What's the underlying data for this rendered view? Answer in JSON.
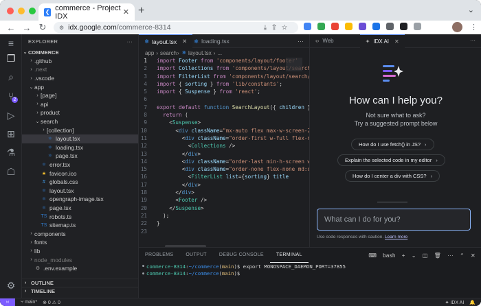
{
  "browser": {
    "tab_title": "commerce - Project IDX",
    "url_host": "idx.google.com",
    "url_path": "/commerce-8314"
  },
  "explorer": {
    "header": "EXPLORER",
    "root": "COMMERCE",
    "items": [
      {
        "label": ".github",
        "depth": 1,
        "kind": "folder",
        "open": false,
        "dim": false
      },
      {
        "label": ".next",
        "depth": 1,
        "kind": "folder",
        "open": false,
        "dim": true
      },
      {
        "label": ".vscode",
        "depth": 1,
        "kind": "folder",
        "open": false,
        "dim": false
      },
      {
        "label": "app",
        "depth": 1,
        "kind": "folder",
        "open": true,
        "dim": false
      },
      {
        "label": "[page]",
        "depth": 2,
        "kind": "folder",
        "open": false,
        "dim": false
      },
      {
        "label": "api",
        "depth": 2,
        "kind": "folder",
        "open": false,
        "dim": false
      },
      {
        "label": "product",
        "depth": 2,
        "kind": "folder",
        "open": false,
        "dim": false
      },
      {
        "label": "search",
        "depth": 2,
        "kind": "folder",
        "open": true,
        "dim": false
      },
      {
        "label": "[collection]",
        "depth": 3,
        "kind": "folder",
        "open": false,
        "dim": false
      },
      {
        "label": "layout.tsx",
        "depth": 3,
        "kind": "tsx",
        "selected": true
      },
      {
        "label": "loading.tsx",
        "depth": 3,
        "kind": "tsx"
      },
      {
        "label": "page.tsx",
        "depth": 3,
        "kind": "tsx"
      },
      {
        "label": "error.tsx",
        "depth": 2,
        "kind": "tsx"
      },
      {
        "label": "favicon.ico",
        "depth": 2,
        "kind": "ico"
      },
      {
        "label": "globals.css",
        "depth": 2,
        "kind": "css"
      },
      {
        "label": "layout.tsx",
        "depth": 2,
        "kind": "tsx"
      },
      {
        "label": "opengraph-image.tsx",
        "depth": 2,
        "kind": "tsx"
      },
      {
        "label": "page.tsx",
        "depth": 2,
        "kind": "tsx"
      },
      {
        "label": "robots.ts",
        "depth": 2,
        "kind": "ts"
      },
      {
        "label": "sitemap.ts",
        "depth": 2,
        "kind": "ts"
      },
      {
        "label": "components",
        "depth": 1,
        "kind": "folder",
        "open": false,
        "dim": false
      },
      {
        "label": "fonts",
        "depth": 1,
        "kind": "folder",
        "open": false,
        "dim": false
      },
      {
        "label": "lib",
        "depth": 1,
        "kind": "folder",
        "open": false,
        "dim": false
      },
      {
        "label": "node_modules",
        "depth": 1,
        "kind": "folder",
        "open": false,
        "dim": true
      },
      {
        "label": ".env.example",
        "depth": 1,
        "kind": "env"
      }
    ],
    "outline": "OUTLINE",
    "timeline": "TIMELINE"
  },
  "editor": {
    "tabs": [
      "layout.tsx",
      "loading.tsx"
    ],
    "breadcrumb": [
      "app",
      "search",
      "layout.tsx",
      "..."
    ],
    "lines": [
      [
        [
          "kw",
          "import "
        ],
        [
          "va",
          "Footer "
        ],
        [
          "kw",
          "from "
        ],
        [
          "st",
          "'components/layout/footer'"
        ]
      ],
      [
        [
          "kw",
          "import "
        ],
        [
          "va",
          "Collections "
        ],
        [
          "kw",
          "from "
        ],
        [
          "st",
          "'components/layout/search/collections'"
        ]
      ],
      [
        [
          "kw",
          "import "
        ],
        [
          "va",
          "FilterList "
        ],
        [
          "kw",
          "from "
        ],
        [
          "st",
          "'components/layout/search/filter'"
        ]
      ],
      [
        [
          "kw",
          "import "
        ],
        [
          "ct",
          "{ "
        ],
        [
          "va",
          "sorting "
        ],
        [
          "ct",
          "} "
        ],
        [
          "kw",
          "from "
        ],
        [
          "st",
          "'lib/constants'"
        ],
        [
          "ct",
          ";"
        ]
      ],
      [
        [
          "kw",
          "import "
        ],
        [
          "ct",
          "{ "
        ],
        [
          "va",
          "Suspense "
        ],
        [
          "ct",
          "} "
        ],
        [
          "kw",
          "from "
        ],
        [
          "st",
          "'react'"
        ],
        [
          "ct",
          ";"
        ]
      ],
      [],
      [
        [
          "kw",
          "export default "
        ],
        [
          "kb",
          "function "
        ],
        [
          "fn",
          "SearchLayout"
        ],
        [
          "ct",
          "({ "
        ],
        [
          "va",
          "children"
        ],
        [
          "ct",
          " }"
        ]
      ],
      [
        [
          "ct",
          "  "
        ],
        [
          "kw",
          "return "
        ],
        [
          "ct",
          "("
        ]
      ],
      [
        [
          "ct",
          "    <"
        ],
        [
          "tg",
          "Suspense"
        ],
        [
          "ct",
          ">"
        ]
      ],
      [
        [
          "ct",
          "      <"
        ],
        [
          "kb",
          "div "
        ],
        [
          "at",
          "className"
        ],
        [
          "ct",
          "="
        ],
        [
          "st",
          "\"mx-auto flex max-w-screen-2xl\""
        ]
      ],
      [
        [
          "ct",
          "        <"
        ],
        [
          "kb",
          "div "
        ],
        [
          "at",
          "className"
        ],
        [
          "ct",
          "="
        ],
        [
          "st",
          "\"order-first w-full flex-none\""
        ]
      ],
      [
        [
          "ct",
          "          <"
        ],
        [
          "tg",
          "Collections "
        ],
        [
          "ct",
          "/>"
        ]
      ],
      [
        [
          "ct",
          "        </"
        ],
        [
          "kb",
          "div"
        ],
        [
          "ct",
          ">"
        ]
      ],
      [
        [
          "ct",
          "        <"
        ],
        [
          "kb",
          "div "
        ],
        [
          "at",
          "className"
        ],
        [
          "ct",
          "="
        ],
        [
          "st",
          "\"order-last min-h-screen w-full\""
        ]
      ],
      [
        [
          "ct",
          "        <"
        ],
        [
          "kb",
          "div "
        ],
        [
          "at",
          "className"
        ],
        [
          "ct",
          "="
        ],
        [
          "st",
          "\"order-none flex-none md:order-last\""
        ]
      ],
      [
        [
          "ct",
          "          <"
        ],
        [
          "tg",
          "FilterList "
        ],
        [
          "at",
          "list"
        ],
        [
          "ct",
          "={"
        ],
        [
          "va",
          "sorting"
        ],
        [
          "ct",
          "} "
        ],
        [
          "at",
          "title"
        ]
      ],
      [
        [
          "ct",
          "        </"
        ],
        [
          "kb",
          "div"
        ],
        [
          "ct",
          ">"
        ]
      ],
      [
        [
          "ct",
          "      </"
        ],
        [
          "kb",
          "div"
        ],
        [
          "ct",
          ">"
        ]
      ],
      [
        [
          "ct",
          "      <"
        ],
        [
          "tg",
          "Footer "
        ],
        [
          "ct",
          "/>"
        ]
      ],
      [
        [
          "ct",
          "    </"
        ],
        [
          "tg",
          "Suspense"
        ],
        [
          "ct",
          ">"
        ]
      ],
      [
        [
          "ct",
          "  );"
        ]
      ],
      [
        [
          "ct",
          "}"
        ]
      ],
      []
    ]
  },
  "panel": {
    "tabs": [
      "PROBLEMS",
      "OUTPUT",
      "DEBUG CONSOLE",
      "TERMINAL"
    ],
    "active_tab": "TERMINAL",
    "shell": "bash",
    "terminal_lines": [
      {
        "prompt": "commerce-8314",
        "path": "~/commerce",
        "branch": "main",
        "cmd": " export MONOSPACE_DAEMON_PORT=37855"
      },
      {
        "prompt": "commerce-8314",
        "path": "~/commerce",
        "branch": "main",
        "cmd": ""
      }
    ]
  },
  "ai": {
    "tabs": [
      "Web",
      "IDX AI"
    ],
    "heading": "How can I help you?",
    "sub1": "Not sure what to ask?",
    "sub2": "Try a suggested prompt below",
    "prompts": [
      "How do I use fetch() in JS?",
      "Explain the selected code in my editor",
      "How do I center a div with CSS?"
    ],
    "input_placeholder": "What can I do for you?",
    "caution": "Use code responses with caution.",
    "learn_more": "Learn more"
  },
  "statusbar": {
    "branch": "main*",
    "errors": "0",
    "warnings": "0",
    "ai_label": "IDX AI"
  },
  "colors": {
    "accent": "#7c5cff",
    "editor_bg": "#1e1f22"
  }
}
